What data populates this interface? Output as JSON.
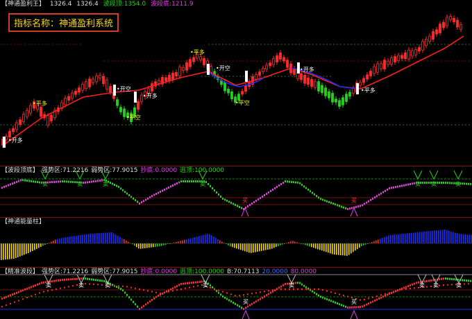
{
  "main_panel": {
    "title": "【神通盈利王】",
    "v1": "1326.4",
    "v2": "1326.4",
    "w_label": "波段顶:",
    "w_value": "1354.0",
    "b_label": "波段底:",
    "b_value": "1211.9",
    "indicator_box": "指标名称：神通盈利系统",
    "signals": [
      "开多",
      "平多",
      "开空",
      "平空",
      "开多",
      "平多",
      "开空",
      "平空",
      "开多",
      "平多"
    ]
  },
  "panel2": {
    "title": "【波段顶底】",
    "strong": "强势区:71.2216",
    "weak": "弱势区:77.9015",
    "buy": "抄底:0.0000",
    "escape": "逃顶:100.0000",
    "mark_sell": "卖",
    "mark_buy": "买"
  },
  "panel3": {
    "title": "【神通能量柱】"
  },
  "panel4": {
    "title": "【精准波段】",
    "strong": "强势区:71.2216",
    "weak": "弱势区:77.9015",
    "buy": "抄底:0.0000",
    "escape": "逃顶:100.0000",
    "b": "B:70.7113",
    "v20": "20.0000",
    "v80": "80.0000",
    "mark_sell": "卖",
    "mark_buy": "买"
  },
  "colors": {
    "up": "#ff2a2a",
    "down": "#00d0d0",
    "ma_red": "#ff1e1e",
    "ma_blue": "#1e2dff",
    "green": "#25d31a",
    "magenta": "#e040e0",
    "yellow": "#f5d90a"
  }
}
